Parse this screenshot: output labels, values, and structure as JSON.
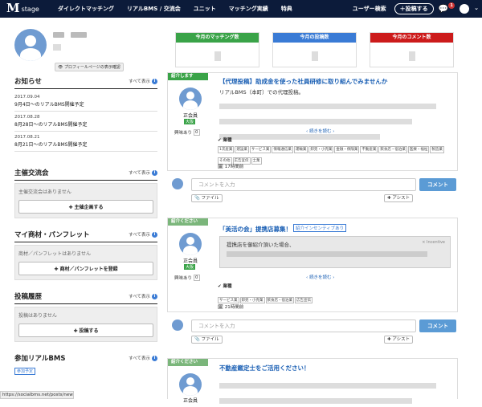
{
  "nav": {
    "logo_mark": "M",
    "logo_text": "stage",
    "items": [
      "ダイレクトマッチング",
      "リアルBMS / 交流会",
      "ユニット",
      "マッチング実績",
      "特典"
    ],
    "user_search": "ユーザー検索",
    "post_button": "＋投稿する",
    "notif_count": "1",
    "chevron": "⌄"
  },
  "profile": {
    "view_button": "プロフィールページの表示確認"
  },
  "notices": {
    "title": "お知らせ",
    "all": "すべて表示",
    "items": [
      {
        "date": "2017.09.04",
        "text": "9月4日〜のリアルBMS開催予定"
      },
      {
        "date": "2017.08.28",
        "text": "8月28日〜のリアルBMS開催予定"
      },
      {
        "date": "2017.08.21",
        "text": "8月21日〜のリアルBMS開催予定"
      }
    ]
  },
  "events": {
    "title": "主催交流会",
    "all": "すべて表示",
    "empty": "主催交流会はありません",
    "button": "✚ 主催企画する"
  },
  "materials": {
    "title": "マイ商材・パンフレット",
    "all": "すべて表示",
    "empty": "商材／パンフレットはありません",
    "button": "✚ 商材／パンフレットを登録"
  },
  "history": {
    "title": "投稿履歴",
    "all": "すべて表示",
    "empty": "投稿はありません",
    "button": "✚ 投稿する"
  },
  "bms": {
    "title": "参加リアルBMS",
    "all": "すべて表示",
    "badge": "参加予定"
  },
  "status_url": "https://socialbms.net/posts/new",
  "stats": [
    {
      "label": "今月のマッチング数",
      "color": "#3aa348"
    },
    {
      "label": "今月の投稿数",
      "color": "#3a7bd5"
    },
    {
      "label": "今月のコメント数",
      "color": "#cc1b1b"
    }
  ],
  "posts": [
    {
      "tag": "紹介します",
      "tag_color": "#3aa348",
      "title": "【代理投稿】助成金を使った社員研修に取り組んでみませんか",
      "body": "リアルBMS（本町）での代理投稿。",
      "member": "正会員",
      "size_badge": "大阪",
      "interest_label": "興味あり",
      "interest_count": "0",
      "read_more": "続きを読む",
      "industry_label": "業種",
      "industries": [
        "1次産業",
        "建設業",
        "サービス業",
        "情報通信業",
        "運輸業",
        "卸売・小売業",
        "金融・保険業",
        "不動産業",
        "飲食店・宿泊業",
        "医療・福祉",
        "製造業",
        "その他",
        "広告宣伝",
        "士業"
      ],
      "time": "17時間前"
    },
    {
      "tag": "紹介ください",
      "tag_color": "#7bb67b",
      "title": "「美活の会」提携店募集！",
      "incentive_badge": "紹介インセンティブあり",
      "incentive_note": "提携店を御紹介頂いた場合、",
      "incentive_label": "Incentive",
      "member": "正会員",
      "size_badge": "大阪",
      "interest_label": "興味あり",
      "interest_count": "0",
      "read_more": "続きを読む",
      "industry_label": "業種",
      "industries": [
        "サービス業",
        "卸売・小売業",
        "飲食店・宿泊業",
        "広告宣伝"
      ],
      "time": "21時間前"
    },
    {
      "tag": "紹介ください",
      "tag_color": "#7bb67b",
      "title": "不動産鑑定士をご活用ください！",
      "member": "正会員"
    }
  ],
  "comment": {
    "placeholder": "コメントを入力",
    "submit": "コメント",
    "file": "ファイル",
    "assist": "アシスト"
  }
}
